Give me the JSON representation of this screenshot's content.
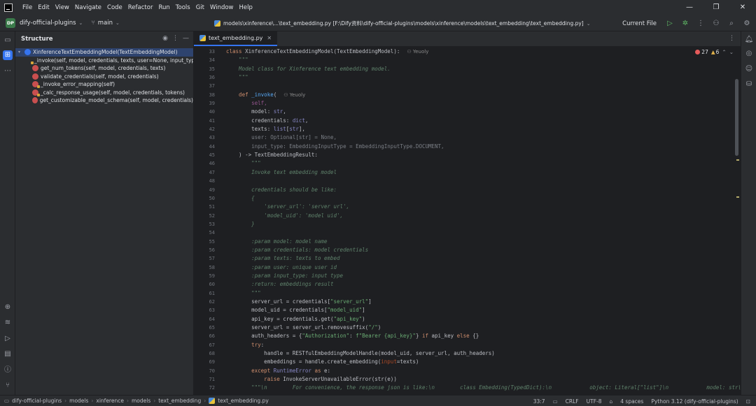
{
  "menu": [
    "File",
    "Edit",
    "View",
    "Navigate",
    "Code",
    "Refactor",
    "Run",
    "Tools",
    "Git",
    "Window",
    "Help"
  ],
  "window_controls": {
    "minimize": "—",
    "maximize": "❐",
    "close": "✕"
  },
  "toolbar": {
    "project_badge": "DP",
    "project_name": "dify-official-plugins",
    "branch": "main",
    "path": "models\\xinference\\...\\text_embedding.py [F:\\Dify资料\\dify-official-plugins\\models\\xinference\\models\\text_embedding\\text_embedding.py]",
    "run_config": "Current File"
  },
  "structure": {
    "title": "Structure",
    "root": "XinferenceTextEmbeddingModel(TextEmbeddingModel)",
    "methods": [
      "_invoke(self, model, credentials, texts, user=None, input_type=Embe",
      "get_num_tokens(self, model, credentials, texts)",
      "validate_credentials(self, model, credentials)",
      "_invoke_error_mapping(self)",
      "_calc_response_usage(self, model, credentials, tokens)",
      "get_customizable_model_schema(self, model, credentials)"
    ]
  },
  "editor": {
    "tab_label": "text_embedding.py",
    "errors": "27",
    "warnings": "6",
    "author_hint": "Yeuoly",
    "line_numbers": [
      "33",
      "34",
      "35",
      "36",
      "37",
      "38",
      "39",
      "40",
      "41",
      "42",
      "43",
      "44",
      "45",
      "46",
      "47",
      "48",
      "49",
      "50",
      "51",
      "52",
      "53",
      "54",
      "55",
      "56",
      "57",
      "58",
      "59",
      "60",
      "61",
      "62",
      "63",
      "64",
      "65",
      "66",
      "67",
      "68",
      "69",
      "70",
      "71",
      "72"
    ],
    "code": {
      "l33_kw": "class ",
      "l33_name": "XinferenceTextEmbeddingModel",
      "l33_rest": "(TextEmbeddingModel):",
      "l34": "    \"\"\"",
      "l35": "    Model class for Xinference text embedding model.",
      "l36": "    \"\"\"",
      "l37": "",
      "l38_kw": "    def ",
      "l38_fn": "_invoke",
      "l38_rest": "(",
      "l39": "        self,",
      "l40_a": "        model: ",
      "l40_b": "str",
      "l40_c": ",",
      "l41_a": "        credentials: ",
      "l41_b": "dict",
      "l41_c": ",",
      "l42_a": "        texts: ",
      "l42_b": "list",
      "l42_c": "[",
      "l42_d": "str",
      "l42_e": "],",
      "l43": "        user: Optional[str] = None,",
      "l44": "        input_type: EmbeddingInputType = EmbeddingInputType.DOCUMENT,",
      "l45": "    ) -> TextEmbeddingResult:",
      "l46": "        \"\"\"",
      "l47": "        Invoke text embedding model",
      "l48": "",
      "l49": "        credentials should be like:",
      "l50": "        {",
      "l51": "            'server_url': 'server url',",
      "l52": "            'model_uid': 'model uid',",
      "l53": "        }",
      "l54": "",
      "l55": "        :param model: model name",
      "l56": "        :param credentials: model credentials",
      "l57": "        :param texts: texts to embed",
      "l58": "        :param user: unique user id",
      "l59": "        :param input_type: input type",
      "l60": "        :return: embeddings result",
      "l61": "        \"\"\"",
      "l62_a": "        server_url = credentials[",
      "l62_b": "\"server_url\"",
      "l62_c": "]",
      "l63_a": "        model_uid = credentials[",
      "l63_b": "\"model_uid\"",
      "l63_c": "]",
      "l64_a": "        api_key = credentials.get(",
      "l64_b": "\"api_key\"",
      "l64_c": ")",
      "l65_a": "        server_url = server_url.removesuffix(",
      "l65_b": "\"/\"",
      "l65_c": ")",
      "l66_a": "        auth_headers = {",
      "l66_b": "\"Authorization\"",
      "l66_c": ": ",
      "l66_d": "f\"Bearer {api_key}\"",
      "l66_e": "} ",
      "l66_f": "if",
      "l66_g": " api_key ",
      "l66_h": "else",
      "l66_i": " {}",
      "l67_kw": "        try",
      "l67_rest": ":",
      "l68": "            handle = RESTfulEmbeddingModelHandle(model_uid, server_url, auth_headers)",
      "l69_a": "            embeddings = handle.create_embedding(",
      "l69_b": "input",
      "l69_c": "=texts)",
      "l70_kw": "        except ",
      "l70_b": "RuntimeError",
      "l70_c": " ",
      "l70_d": "as",
      "l70_e": " e:",
      "l71_kw": "            raise ",
      "l71_rest": "InvokeServerUnavailableError(str(e))",
      "l72": "        \"\"\"\\n        For convenience, the response json is like:\\n        class Embedding(TypedDict):\\n            object: Literal[\"list\"]\\n            model: str\\n"
    }
  },
  "statusbar": {
    "crumbs": [
      "dify-official-plugins",
      "models",
      "xinference",
      "models",
      "text_embedding",
      "text_embedding.py"
    ],
    "position": "33:7",
    "line_sep": "CRLF",
    "encoding": "UTF-8",
    "indent": "4 spaces",
    "interpreter": "Python 3.12 (dify-official-plugins)"
  },
  "colors": {
    "accent": "#3574f0",
    "error": "#e55b5b",
    "warning": "#e0b14a",
    "run": "#5fb865"
  }
}
